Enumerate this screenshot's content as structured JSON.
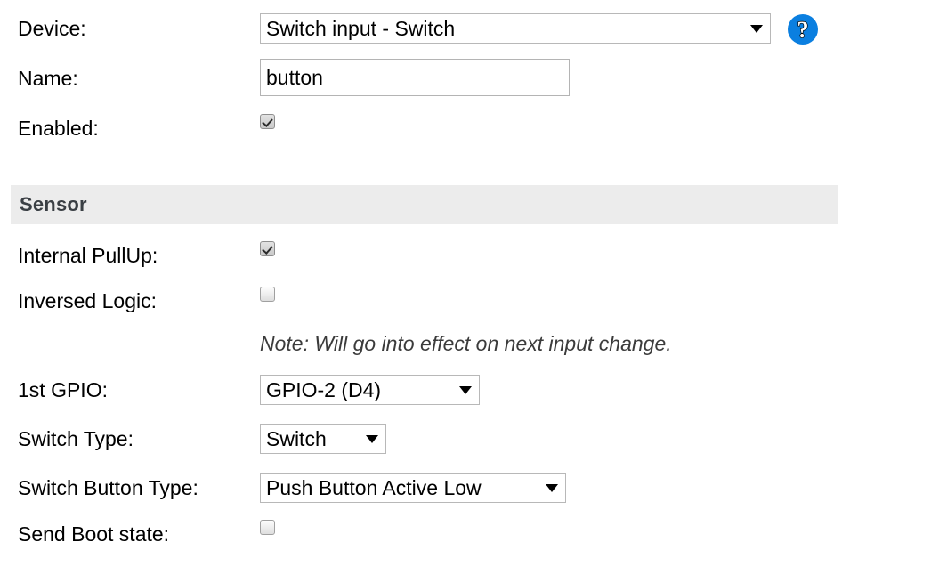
{
  "form": {
    "device": {
      "label": "Device:",
      "value": "Switch input - Switch",
      "help_icon": "question-mark-icon"
    },
    "name": {
      "label": "Name:",
      "value": "button",
      "placeholder": ""
    },
    "enabled": {
      "label": "Enabled:",
      "checked": true
    }
  },
  "sensor": {
    "header": "Sensor",
    "internal_pullup": {
      "label": "Internal PullUp:",
      "checked": true
    },
    "inversed_logic": {
      "label": "Inversed Logic:",
      "checked": false
    },
    "note": "Note: Will go into effect on next input change.",
    "first_gpio": {
      "label": "1st GPIO:",
      "value": "GPIO-2 (D4)"
    },
    "switch_type": {
      "label": "Switch Type:",
      "value": "Switch"
    },
    "switch_button_type": {
      "label": "Switch Button Type:",
      "value": "Push Button Active Low"
    },
    "send_boot_state": {
      "label": "Send Boot state:",
      "checked": false
    }
  },
  "colors": {
    "help_icon_blue": "#0b7fe0",
    "section_header_bg": "#ececec",
    "section_header_text": "#3a3f44",
    "border": "#b8b8b8"
  }
}
